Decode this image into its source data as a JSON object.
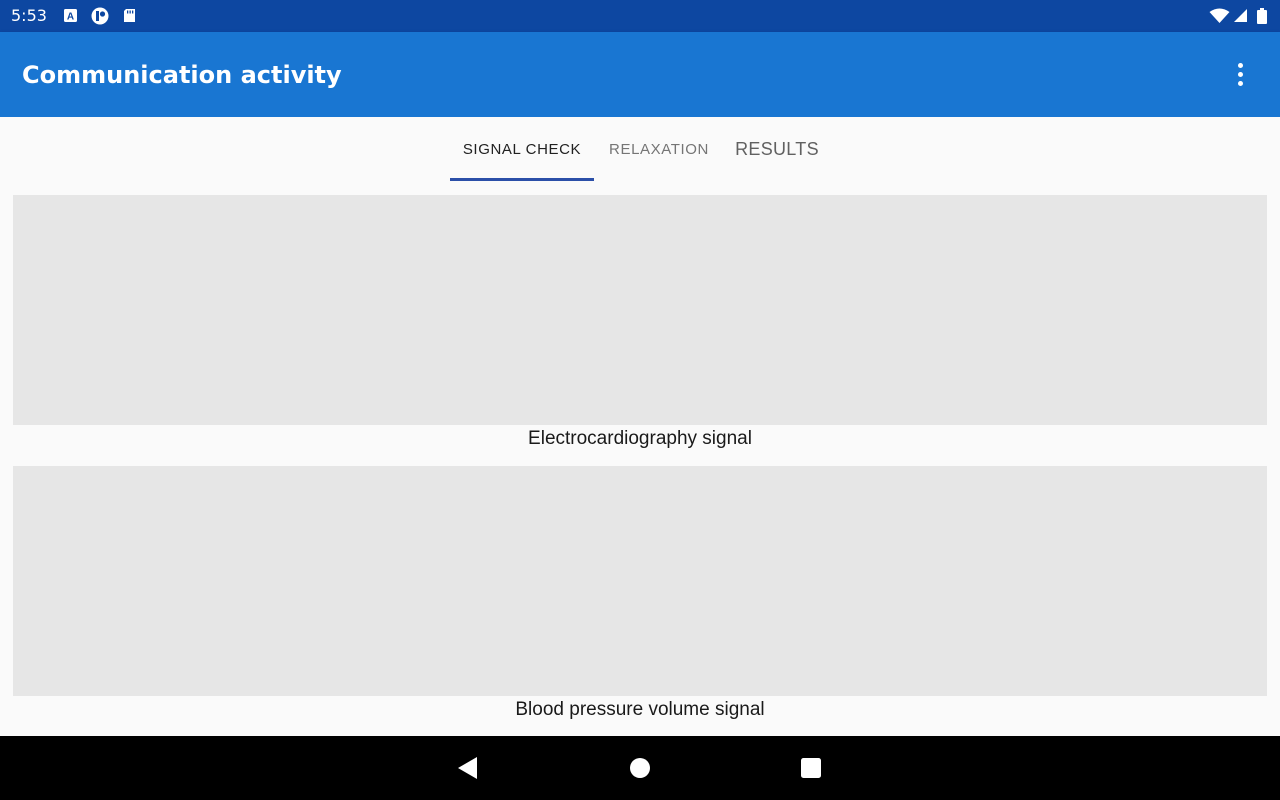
{
  "status_bar": {
    "time": "5:53",
    "left_icons": [
      "a-box-icon",
      "circle-badge-icon",
      "sd-card-icon"
    ],
    "right_icons": [
      "wifi-icon",
      "signal-icon",
      "battery-icon"
    ]
  },
  "app_bar": {
    "title": "Communication activity",
    "menu_icon": "more-vert-icon"
  },
  "tabs": [
    {
      "label": "SIGNAL CHECK",
      "selected": true
    },
    {
      "label": "RELAXATION",
      "selected": false
    },
    {
      "label": "RESULTS",
      "selected": false
    }
  ],
  "signals": [
    {
      "caption": "Electrocardiography signal"
    },
    {
      "caption": "Blood pressure volume signal"
    }
  ],
  "nav_bar": {
    "buttons": [
      "back-icon",
      "home-icon",
      "recents-icon"
    ]
  },
  "colors": {
    "status_bar": "#0d47a1",
    "app_bar": "#1976d2",
    "tab_indicator": "#2b4fa8",
    "panel": "#e6e6e6",
    "background": "#fafafa"
  }
}
